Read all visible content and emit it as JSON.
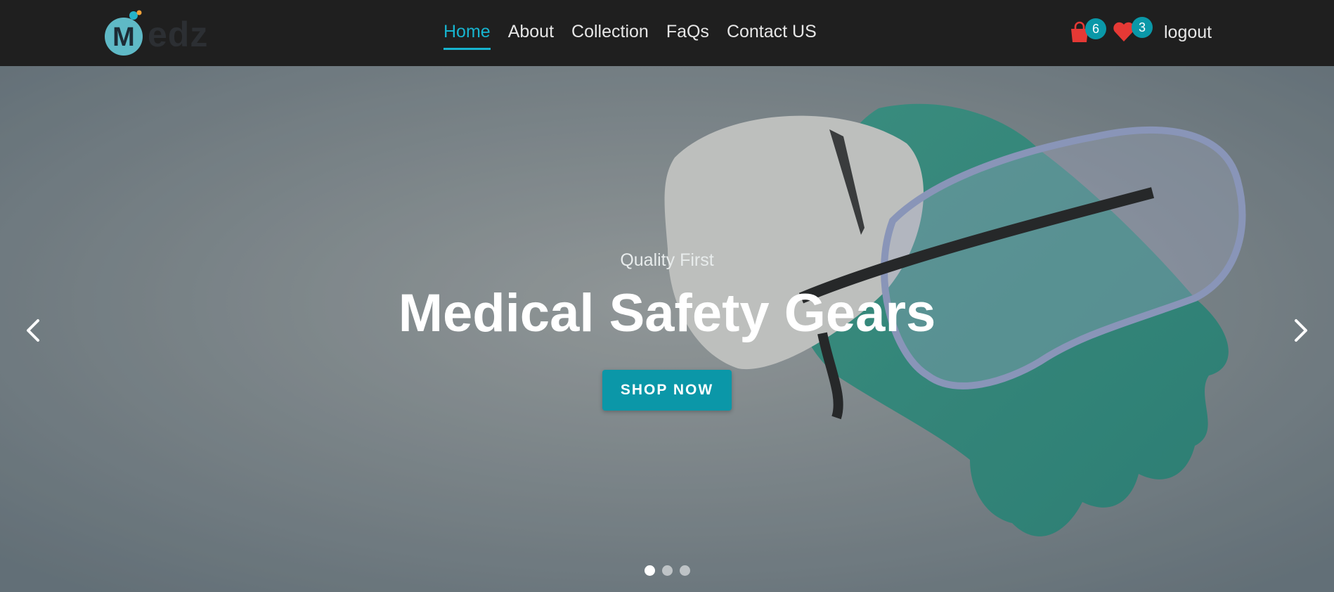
{
  "brand": {
    "logo_text": "edz",
    "logo_initial": "M"
  },
  "nav": {
    "links": [
      {
        "label": "Home",
        "active": true
      },
      {
        "label": "About",
        "active": false
      },
      {
        "label": "Collection",
        "active": false
      },
      {
        "label": "FaQs",
        "active": false
      },
      {
        "label": "Contact US",
        "active": false
      }
    ]
  },
  "header_actions": {
    "cart_icon": "shopping-bag-icon",
    "cart_count": "6",
    "wishlist_icon": "heart-icon",
    "wishlist_count": "3",
    "logout_label": "logout"
  },
  "hero": {
    "eyebrow": "Quality First",
    "headline": "Medical Safety Gears",
    "cta_label": "SHOP NOW",
    "prev_icon": "chevron-left-icon",
    "next_icon": "chevron-right-icon",
    "slide_count": 3,
    "active_slide": 1
  },
  "colors": {
    "accent": "#17b4cf",
    "button": "#0b97a8",
    "navbar_bg": "#1f1f1f",
    "cart_icon": "#e53935",
    "heart_icon": "#e53935"
  }
}
